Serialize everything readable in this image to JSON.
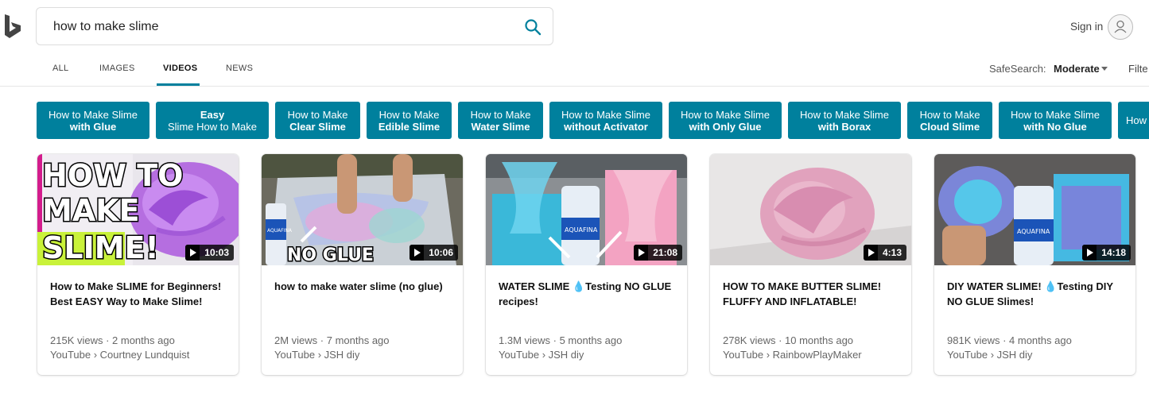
{
  "search": {
    "query": "how to make slime"
  },
  "header": {
    "signin": "Sign in"
  },
  "tabs": [
    {
      "label": "ALL"
    },
    {
      "label": "IMAGES"
    },
    {
      "label": "VIDEOS"
    },
    {
      "label": "NEWS"
    }
  ],
  "safesearch": {
    "label": "SafeSearch:",
    "value": "Moderate"
  },
  "filter": {
    "label": "Filte"
  },
  "chips": [
    {
      "line1": "How to Make Slime",
      "line2": "with Glue"
    },
    {
      "line1": "Easy",
      "line2": "Slime How to Make"
    },
    {
      "line1": "How to Make",
      "line2": "Clear Slime"
    },
    {
      "line1": "How to Make",
      "line2": "Edible Slime"
    },
    {
      "line1": "How to Make",
      "line2": "Water Slime"
    },
    {
      "line1": "How to Make Slime",
      "line2": "without Activator"
    },
    {
      "line1": "How to Make Slime",
      "line2": "with Only Glue"
    },
    {
      "line1": "How to Make Slime",
      "line2": "with Borax"
    },
    {
      "line1": "How to Make",
      "line2": "Cloud Slime"
    },
    {
      "line1": "How to Make Slime",
      "line2": "with No Glue"
    },
    {
      "line1": "How",
      "line2": ""
    }
  ],
  "videos": [
    {
      "duration": "10:03",
      "title": "How to Make SLIME for Beginners! Best EASY Way to Make Slime!",
      "stats": "215K views · 2 months ago",
      "source": "YouTube › Courtney Lundquist",
      "thumb_text": [
        "HOW TO",
        "MAKE",
        "SLIME!"
      ]
    },
    {
      "duration": "10:06",
      "title": "how to make water slime (no glue)",
      "stats": "2M views · 7 months ago",
      "source": "YouTube › JSH diy",
      "thumb_text": [
        "NO GLUE",
        "AQUAFINA"
      ]
    },
    {
      "duration": "21:08",
      "title": "WATER SLIME 💧Testing NO GLUE recipes!",
      "stats": "1.3M views · 5 months ago",
      "source": "YouTube › JSH diy",
      "thumb_text": [
        "AQUAFINA"
      ]
    },
    {
      "duration": "4:13",
      "title": "HOW TO MAKE BUTTER SLIME! FLUFFY AND INFLATABLE!",
      "stats": "278K views · 10 months ago",
      "source": "YouTube › RainbowPlayMaker",
      "thumb_text": []
    },
    {
      "duration": "14:18",
      "title": "DIY WATER SLIME! 💧Testing DIY NO GLUE Slimes!",
      "stats": "981K views · 4 months ago",
      "source": "YouTube › JSH diy",
      "thumb_text": [
        "AQUAFINA"
      ]
    }
  ],
  "colors": {
    "accent": "#00809d",
    "chip_bg": "#00809d"
  }
}
